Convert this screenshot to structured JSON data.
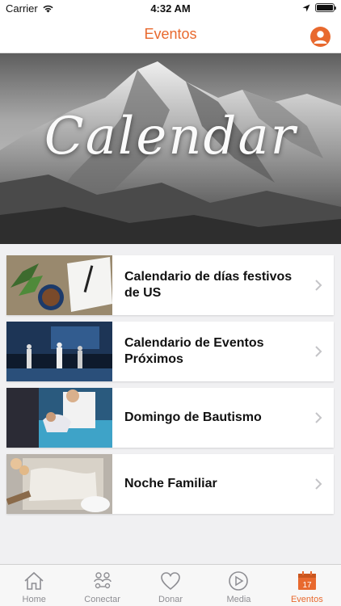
{
  "status_bar": {
    "carrier": "Carrier",
    "time": "4:32 AM"
  },
  "nav": {
    "title": "Eventos"
  },
  "hero": {
    "title": "Calendar"
  },
  "events": [
    {
      "label": "Calendario de días festivos de US",
      "thumb": "table-notebook-photo"
    },
    {
      "label": "Calendario de Eventos Próximos",
      "thumb": "stage-worship-photo"
    },
    {
      "label": "Domingo de Bautismo",
      "thumb": "baptism-photo"
    },
    {
      "label": "Noche Familiar",
      "thumb": "family-baking-photo"
    }
  ],
  "tabs": [
    {
      "label": "Home",
      "icon": "house-icon",
      "active": false
    },
    {
      "label": "Conectar",
      "icon": "people-icon",
      "active": false
    },
    {
      "label": "Donar",
      "icon": "heart-icon",
      "active": false
    },
    {
      "label": "Media",
      "icon": "play-icon",
      "active": false
    },
    {
      "label": "Eventos",
      "icon": "calendar-icon",
      "active": true,
      "badge": "17"
    }
  ],
  "colors": {
    "accent": "#e8692e",
    "tab_inactive": "#8e8e93"
  }
}
